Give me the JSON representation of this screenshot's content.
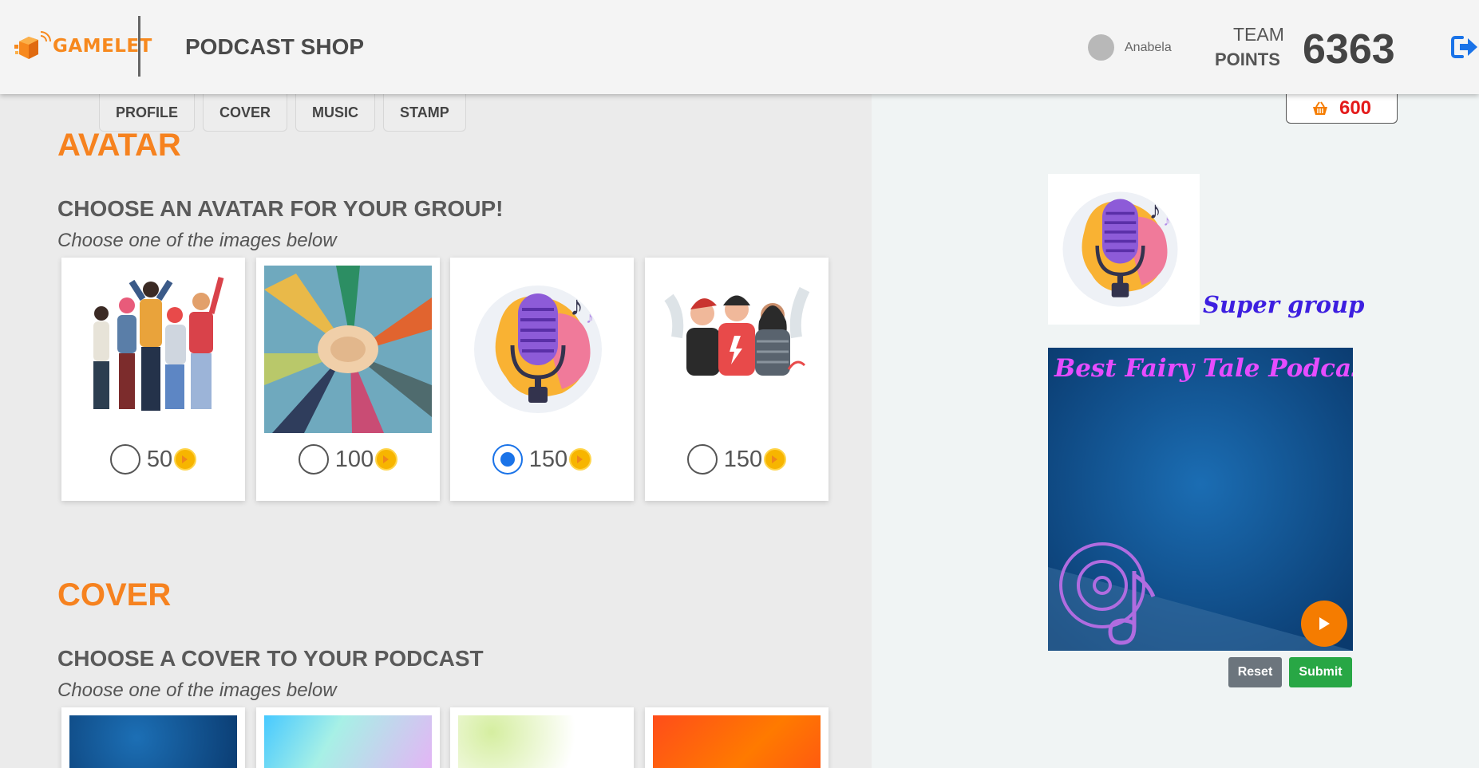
{
  "header": {
    "logo_text": "GAMELET",
    "title": "PODCAST SHOP",
    "user_name": "Anabela",
    "team_label": "TEAM",
    "points_label": "POINTS",
    "team_points": "6363"
  },
  "tabs": [
    {
      "label": "PROFILE"
    },
    {
      "label": "COVER"
    },
    {
      "label": "MUSIC"
    },
    {
      "label": "STAMP"
    }
  ],
  "avatar_section": {
    "title": "AVATAR",
    "subtitle": "CHOOSE AN AVATAR FOR YOUR GROUP!",
    "hint": "Choose one of the images below",
    "options": [
      {
        "price": "50",
        "selected": false,
        "image": "group-of-friends-cheering"
      },
      {
        "price": "100",
        "selected": false,
        "image": "team-hands-together"
      },
      {
        "price": "150",
        "selected": true,
        "image": "microphone-with-music-note"
      },
      {
        "price": "150",
        "selected": false,
        "image": "three-friends-hugging"
      }
    ]
  },
  "cover_section": {
    "title": "COVER",
    "subtitle": "CHOOSE A COVER TO YOUR PODCAST",
    "hint": "Choose one of the images below"
  },
  "basket": {
    "value": "600"
  },
  "preview": {
    "group_name": "Super group",
    "cover_title": "Best Fairy Tale Podcast",
    "reset_label": "Reset",
    "submit_label": "Submit"
  },
  "colors": {
    "accent": "#f6821f",
    "radio_selected": "#1a73e8",
    "reset": "#6c757d",
    "submit": "#28a745",
    "basket_value": "#e41b1b"
  }
}
